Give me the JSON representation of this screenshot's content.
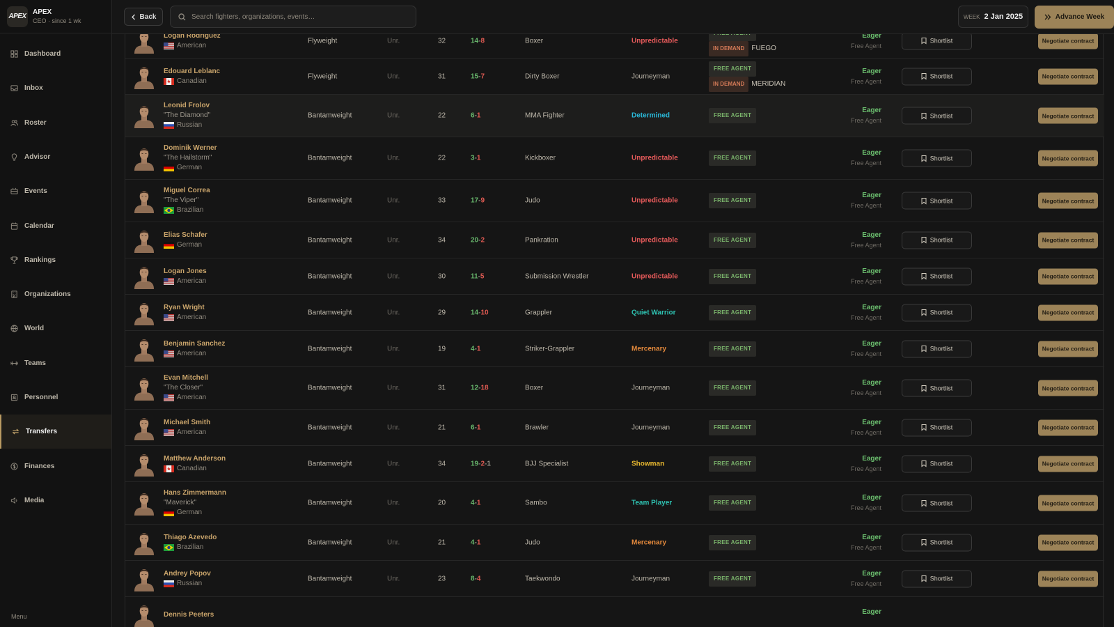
{
  "app": {
    "name": "APEX",
    "logo_text": "APEX",
    "subtitle": "CEO · since 1 wk"
  },
  "sidebar": {
    "items": [
      {
        "label": "Dashboard",
        "icon": "dashboard-icon"
      },
      {
        "label": "Inbox",
        "icon": "inbox-icon"
      },
      {
        "label": "Roster",
        "icon": "roster-icon"
      },
      {
        "label": "Advisor",
        "icon": "advisor-icon"
      },
      {
        "label": "Events",
        "icon": "events-icon"
      },
      {
        "label": "Calendar",
        "icon": "calendar-icon"
      },
      {
        "label": "Rankings",
        "icon": "rankings-icon"
      },
      {
        "label": "Organizations",
        "icon": "organizations-icon"
      },
      {
        "label": "World",
        "icon": "world-icon"
      },
      {
        "label": "Teams",
        "icon": "teams-icon"
      },
      {
        "label": "Personnel",
        "icon": "personnel-icon"
      },
      {
        "label": "Transfers",
        "icon": "transfers-icon",
        "active": true
      },
      {
        "label": "Finances",
        "icon": "finances-icon"
      },
      {
        "label": "Media",
        "icon": "media-icon"
      }
    ],
    "footer": "Menu"
  },
  "topbar": {
    "back_label": "Back",
    "search_placeholder": "Search fighters, organizations, events…",
    "week_label": "WEEK",
    "week_value": "2 Jan 2025",
    "advance_label": "Advance Week"
  },
  "colors": {
    "accent": "#9c8358",
    "name": "#c9a46b",
    "win": "#66b56b",
    "loss": "#df5a52",
    "unpredictable": "#e55a5a",
    "determined": "#2ab8d8",
    "quiet": "#2ec0b0",
    "mercenary": "#e58a3c",
    "showman": "#e8b830",
    "teamplayer": "#2ec0b0",
    "journeyman": "#bdb7aa"
  },
  "fighters": [
    {
      "name": "Logan Rodriguez",
      "nickname": "",
      "nationality": "American",
      "flag": "us",
      "weight_class": "Flyweight",
      "rank": "Unr.",
      "age": "32",
      "record": {
        "w": "14",
        "l": "8",
        "d": ""
      },
      "style": "Boxer",
      "personality": "Unpredictable",
      "pcolor": "#e55a5a",
      "free_agent": "FREE AGENT",
      "in_demand": "IN DEMAND",
      "org": "FUEGO",
      "interest": "Eager",
      "contract": "Free Agent",
      "shortlist": "Shortlist",
      "action": "Negotiate contract"
    },
    {
      "name": "Edouard Leblanc",
      "nickname": "",
      "nationality": "Canadian",
      "flag": "ca",
      "weight_class": "Flyweight",
      "rank": "Unr.",
      "age": "31",
      "record": {
        "w": "15",
        "l": "7",
        "d": ""
      },
      "style": "Dirty Boxer",
      "personality": "Journeyman",
      "pcolor": "#bdb7aa",
      "free_agent": "FREE AGENT",
      "in_demand": "IN DEMAND",
      "org": "MERIDIAN",
      "interest": "Eager",
      "contract": "Free Agent",
      "shortlist": "Shortlist",
      "action": "Negotiate contract"
    },
    {
      "name": "Leonid Frolov",
      "nickname": "\"The Diamond\"",
      "nationality": "Russian",
      "flag": "ru",
      "weight_class": "Bantamweight",
      "rank": "Unr.",
      "age": "22",
      "record": {
        "w": "6",
        "l": "1",
        "d": ""
      },
      "style": "MMA Fighter",
      "personality": "Determined",
      "pcolor": "#2ab8d8",
      "free_agent": "FREE AGENT",
      "in_demand": "",
      "org": "",
      "interest": "Eager",
      "contract": "Free Agent",
      "shortlist": "Shortlist",
      "action": "Negotiate contract"
    },
    {
      "name": "Dominik Werner",
      "nickname": "\"The Hailstorm\"",
      "nationality": "German",
      "flag": "de",
      "weight_class": "Bantamweight",
      "rank": "Unr.",
      "age": "22",
      "record": {
        "w": "3",
        "l": "1",
        "d": ""
      },
      "style": "Kickboxer",
      "personality": "Unpredictable",
      "pcolor": "#e55a5a",
      "free_agent": "FREE AGENT",
      "in_demand": "",
      "org": "",
      "interest": "Eager",
      "contract": "Free Agent",
      "shortlist": "Shortlist",
      "action": "Negotiate contract"
    },
    {
      "name": "Miguel Correa",
      "nickname": "\"The Viper\"",
      "nationality": "Brazilian",
      "flag": "br",
      "weight_class": "Bantamweight",
      "rank": "Unr.",
      "age": "33",
      "record": {
        "w": "17",
        "l": "9",
        "d": ""
      },
      "style": "Judo",
      "personality": "Unpredictable",
      "pcolor": "#e55a5a",
      "free_agent": "FREE AGENT",
      "in_demand": "",
      "org": "",
      "interest": "Eager",
      "contract": "Free Agent",
      "shortlist": "Shortlist",
      "action": "Negotiate contract"
    },
    {
      "name": "Elias Schafer",
      "nickname": "",
      "nationality": "German",
      "flag": "de",
      "weight_class": "Bantamweight",
      "rank": "Unr.",
      "age": "34",
      "record": {
        "w": "20",
        "l": "2",
        "d": ""
      },
      "style": "Pankration",
      "personality": "Unpredictable",
      "pcolor": "#e55a5a",
      "free_agent": "FREE AGENT",
      "in_demand": "",
      "org": "",
      "interest": "Eager",
      "contract": "Free Agent",
      "shortlist": "Shortlist",
      "action": "Negotiate contract"
    },
    {
      "name": "Logan Jones",
      "nickname": "",
      "nationality": "American",
      "flag": "us",
      "weight_class": "Bantamweight",
      "rank": "Unr.",
      "age": "30",
      "record": {
        "w": "11",
        "l": "5",
        "d": ""
      },
      "style": "Submission Wrestler",
      "personality": "Unpredictable",
      "pcolor": "#e55a5a",
      "free_agent": "FREE AGENT",
      "in_demand": "",
      "org": "",
      "interest": "Eager",
      "contract": "Free Agent",
      "shortlist": "Shortlist",
      "action": "Negotiate contract"
    },
    {
      "name": "Ryan Wright",
      "nickname": "",
      "nationality": "American",
      "flag": "us",
      "weight_class": "Bantamweight",
      "rank": "Unr.",
      "age": "29",
      "record": {
        "w": "14",
        "l": "10",
        "d": ""
      },
      "style": "Grappler",
      "personality": "Quiet Warrior",
      "pcolor": "#2ec0b0",
      "free_agent": "FREE AGENT",
      "in_demand": "",
      "org": "",
      "interest": "Eager",
      "contract": "Free Agent",
      "shortlist": "Shortlist",
      "action": "Negotiate contract"
    },
    {
      "name": "Benjamin Sanchez",
      "nickname": "",
      "nationality": "American",
      "flag": "us",
      "weight_class": "Bantamweight",
      "rank": "Unr.",
      "age": "19",
      "record": {
        "w": "4",
        "l": "1",
        "d": ""
      },
      "style": "Striker-Grappler",
      "personality": "Mercenary",
      "pcolor": "#e58a3c",
      "free_agent": "FREE AGENT",
      "in_demand": "",
      "org": "",
      "interest": "Eager",
      "contract": "Free Agent",
      "shortlist": "Shortlist",
      "action": "Negotiate contract"
    },
    {
      "name": "Evan Mitchell",
      "nickname": "\"The Closer\"",
      "nationality": "American",
      "flag": "us",
      "weight_class": "Bantamweight",
      "rank": "Unr.",
      "age": "31",
      "record": {
        "w": "12",
        "l": "18",
        "d": ""
      },
      "style": "Boxer",
      "personality": "Journeyman",
      "pcolor": "#bdb7aa",
      "free_agent": "FREE AGENT",
      "in_demand": "",
      "org": "",
      "interest": "Eager",
      "contract": "Free Agent",
      "shortlist": "Shortlist",
      "action": "Negotiate contract"
    },
    {
      "name": "Michael Smith",
      "nickname": "",
      "nationality": "American",
      "flag": "us",
      "weight_class": "Bantamweight",
      "rank": "Unr.",
      "age": "21",
      "record": {
        "w": "6",
        "l": "1",
        "d": ""
      },
      "style": "Brawler",
      "personality": "Journeyman",
      "pcolor": "#bdb7aa",
      "free_agent": "FREE AGENT",
      "in_demand": "",
      "org": "",
      "interest": "Eager",
      "contract": "Free Agent",
      "shortlist": "Shortlist",
      "action": "Negotiate contract"
    },
    {
      "name": "Matthew Anderson",
      "nickname": "",
      "nationality": "Canadian",
      "flag": "ca",
      "weight_class": "Bantamweight",
      "rank": "Unr.",
      "age": "34",
      "record": {
        "w": "19",
        "l": "2",
        "d": "1"
      },
      "style": "BJJ Specialist",
      "personality": "Showman",
      "pcolor": "#e8b830",
      "free_agent": "FREE AGENT",
      "in_demand": "",
      "org": "",
      "interest": "Eager",
      "contract": "Free Agent",
      "shortlist": "Shortlist",
      "action": "Negotiate contract"
    },
    {
      "name": "Hans Zimmermann",
      "nickname": "\"Maverick\"",
      "nationality": "German",
      "flag": "de",
      "weight_class": "Bantamweight",
      "rank": "Unr.",
      "age": "20",
      "record": {
        "w": "4",
        "l": "1",
        "d": ""
      },
      "style": "Sambo",
      "personality": "Team Player",
      "pcolor": "#2ec0b0",
      "free_agent": "FREE AGENT",
      "in_demand": "",
      "org": "",
      "interest": "Eager",
      "contract": "Free Agent",
      "shortlist": "Shortlist",
      "action": "Negotiate contract"
    },
    {
      "name": "Thiago Azevedo",
      "nickname": "",
      "nationality": "Brazilian",
      "flag": "br",
      "weight_class": "Bantamweight",
      "rank": "Unr.",
      "age": "21",
      "record": {
        "w": "4",
        "l": "1",
        "d": ""
      },
      "style": "Judo",
      "personality": "Mercenary",
      "pcolor": "#e58a3c",
      "free_agent": "FREE AGENT",
      "in_demand": "",
      "org": "",
      "interest": "Eager",
      "contract": "Free Agent",
      "shortlist": "Shortlist",
      "action": "Negotiate contract"
    },
    {
      "name": "Andrey Popov",
      "nickname": "",
      "nationality": "Russian",
      "flag": "ru",
      "weight_class": "Bantamweight",
      "rank": "Unr.",
      "age": "23",
      "record": {
        "w": "8",
        "l": "4",
        "d": ""
      },
      "style": "Taekwondo",
      "personality": "Journeyman",
      "pcolor": "#bdb7aa",
      "free_agent": "FREE AGENT",
      "in_demand": "",
      "org": "",
      "interest": "Eager",
      "contract": "Free Agent",
      "shortlist": "Shortlist",
      "action": "Negotiate contract"
    },
    {
      "name": "Dennis Peeters",
      "nickname": "",
      "nationality": "",
      "flag": "",
      "weight_class": "",
      "rank": "",
      "age": "",
      "record": {
        "w": "",
        "l": "",
        "d": ""
      },
      "style": "",
      "personality": "",
      "pcolor": "#bdb7aa",
      "free_agent": "",
      "in_demand": "",
      "org": "",
      "interest": "Eager",
      "contract": "",
      "shortlist": "",
      "action": ""
    }
  ]
}
